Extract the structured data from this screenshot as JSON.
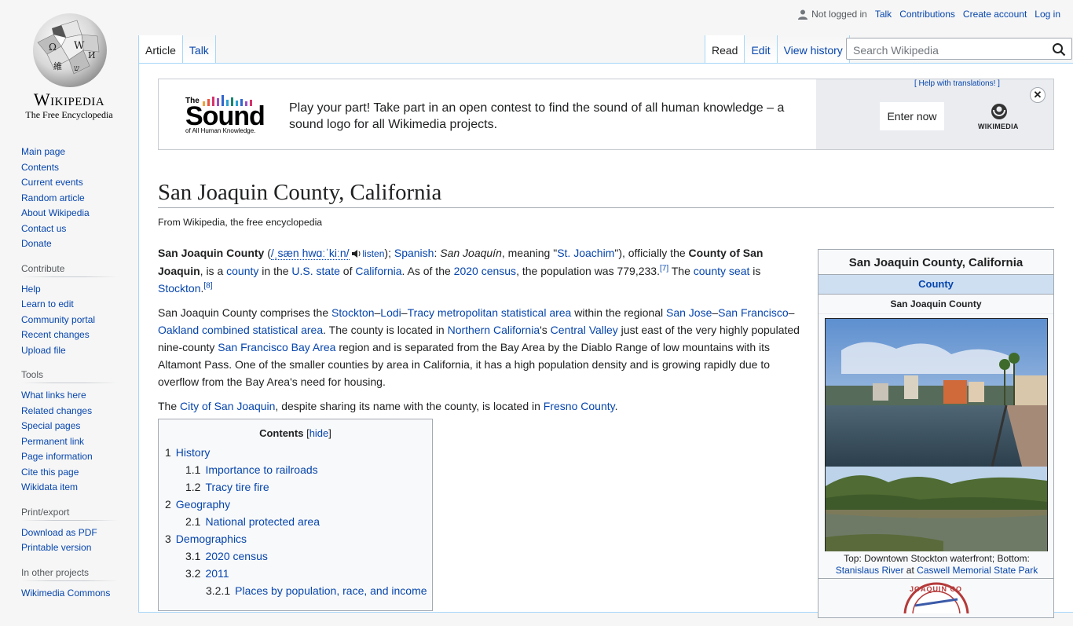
{
  "logo": {
    "wordmark": "Wikipedia",
    "tagline": "The Free Encyclopedia"
  },
  "personal": {
    "not_logged_in": "Not logged in",
    "talk": "Talk",
    "contributions": "Contributions",
    "create_account": "Create account",
    "login": "Log in"
  },
  "tabs": {
    "article": "Article",
    "talk": "Talk",
    "read": "Read",
    "edit": "Edit",
    "view_history": "View history"
  },
  "search": {
    "placeholder": "Search Wikipedia"
  },
  "sidebar": {
    "navigation": [
      "Main page",
      "Contents",
      "Current events",
      "Random article",
      "About Wikipedia",
      "Contact us",
      "Donate"
    ],
    "contribute": {
      "heading": "Contribute",
      "items": [
        "Help",
        "Learn to edit",
        "Community portal",
        "Recent changes",
        "Upload file"
      ]
    },
    "tools": {
      "heading": "Tools",
      "items": [
        "What links here",
        "Related changes",
        "Special pages",
        "Permanent link",
        "Page information",
        "Cite this page",
        "Wikidata item"
      ]
    },
    "print": {
      "heading": "Print/export",
      "items": [
        "Download as PDF",
        "Printable version"
      ]
    },
    "projects": {
      "heading": "In other projects",
      "items": [
        "Wikimedia Commons"
      ]
    }
  },
  "banner": {
    "sound_small": "The",
    "sound_big": "Sound",
    "sound_sub": "of All Human Knowledge.",
    "message": "Play your part! Take part in an open contest to find the sound of all human knowledge – a sound logo for all Wikimedia projects.",
    "help": "[ Help with translations! ]",
    "enter": "Enter now",
    "wikimedia": "WIKIMEDIA",
    "close": "✕"
  },
  "article": {
    "title": "San Joaquin County, California",
    "site_sub": "From Wikipedia, the free encyclopedia",
    "p1": {
      "b1": "San Joaquin County",
      "ipa": "/ˌsæn hwɑːˈkiːn/",
      "listen": "listen",
      "spanish": "Spanish",
      "spanish_name": "San Joaquín",
      "meaning": ", meaning \"",
      "st_joachim": "St. Joachim",
      "officially": "\"), officially the ",
      "b2": "County of San Joaquin",
      "is_a": ", is a ",
      "county": "county",
      "in_the": " in the ",
      "us_state": "U.S. state",
      "of": " of ",
      "california": "California",
      "as_of": ". As of the ",
      "census": "2020 census",
      "population": ", the population was 779,233.",
      "ref7": "[7]",
      "the": " The ",
      "county_seat": "county seat",
      "is": " is ",
      "stockton": "Stockton",
      "ref8": "[8]"
    },
    "p2": {
      "t1": "San Joaquin County comprises the ",
      "l1": "Stockton",
      "d1": "–",
      "l2": "Lodi",
      "d2": "–",
      "l3": "Tracy metropolitan statistical area",
      "t2": " within the regional ",
      "l4": "San Jose",
      "d3": "–",
      "l5": "San Francisco",
      "d4": "–",
      "l6": "Oakland combined statistical area",
      "t3": ". The county is located in ",
      "l7": "Northern California",
      "t4": "'s ",
      "l8": "Central Valley",
      "t5": " just east of the very highly populated nine-county ",
      "l9": "San Francisco Bay Area",
      "t6": " region and is separated from the Bay Area by the Diablo Range of low mountains with its Altamont Pass. One of the smaller counties by area in California, it has a high population density and is growing rapidly due to overflow from the Bay Area's need for housing."
    },
    "p3": {
      "t1": "The ",
      "l1": "City of San Joaquin",
      "t2": ", despite sharing its name with the county, is located in ",
      "l2": "Fresno County",
      "t3": "."
    }
  },
  "toc": {
    "title": "Contents",
    "hide": "hide",
    "items": [
      {
        "num": "1",
        "label": "History",
        "level": 1
      },
      {
        "num": "1.1",
        "label": "Importance to railroads",
        "level": 2
      },
      {
        "num": "1.2",
        "label": "Tracy tire fire",
        "level": 2
      },
      {
        "num": "2",
        "label": "Geography",
        "level": 1
      },
      {
        "num": "2.1",
        "label": "National protected area",
        "level": 2
      },
      {
        "num": "3",
        "label": "Demographics",
        "level": 1
      },
      {
        "num": "3.1",
        "label": "2020 census",
        "level": 2
      },
      {
        "num": "3.2",
        "label": "2011",
        "level": 2
      },
      {
        "num": "3.2.1",
        "label": "Places by population, race, and income",
        "level": 3
      }
    ]
  },
  "infobox": {
    "title": "San Joaquin County, California",
    "type": "County",
    "subtitle": "San Joaquin County",
    "caption_text": "Top: Downtown Stockton waterfront; Bottom:",
    "caption_l1": "Stanislaus River",
    "caption_at": " at ",
    "caption_l2": "Caswell Memorial State Park",
    "seal_text": "JOAQUIN CO"
  },
  "colors": {
    "link": "#0645ad",
    "border": "#a7d7f9",
    "infobox_type_bg": "#cedff2"
  }
}
